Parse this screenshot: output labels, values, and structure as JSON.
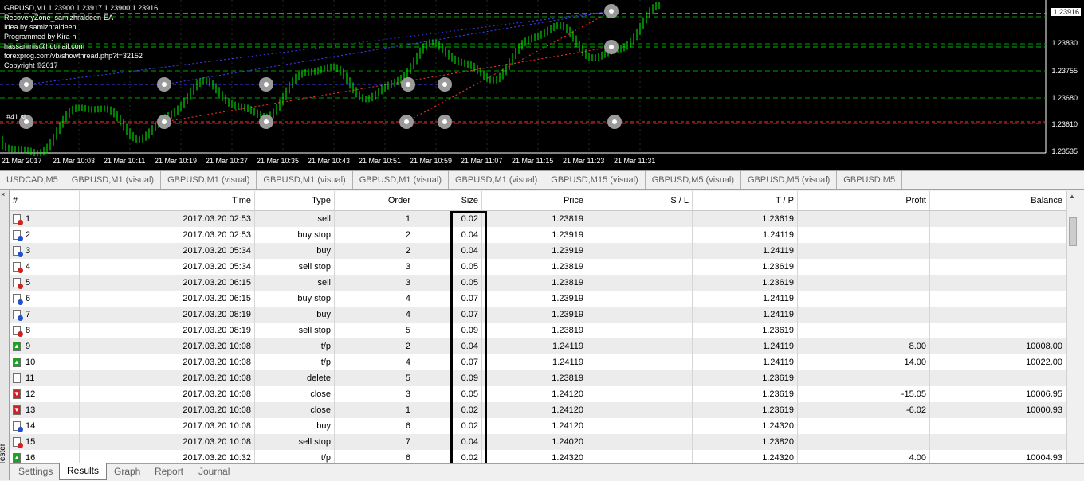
{
  "chart": {
    "ohlc_line": "GBPUSD,M1  1.23900 1.23917 1.23900 1.23916",
    "overlay_lines": [
      "RecoveryZone_samizhraldeen-EA",
      "Idea by samizhraldeen",
      "Programmed by Kira-h",
      "hassanrnis@hotmail.com",
      "forexprog.com/vb/showthread.php?t=32152",
      "Copyright ©2017"
    ],
    "order_label": "#41 sl",
    "price_current": "1.23916",
    "price_labels": [
      "1.23830",
      "1.23755",
      "1.23680",
      "1.23610",
      "1.23535"
    ],
    "time_labels": [
      "21 Mar 2017",
      "21 Mar 10:03",
      "21 Mar 10:11",
      "21 Mar 10:19",
      "21 Mar 10:27",
      "21 Mar 10:35",
      "21 Mar 10:43",
      "21 Mar 10:51",
      "21 Mar 10:59",
      "21 Mar 11:07",
      "21 Mar 11:15",
      "21 Mar 11:23",
      "21 Mar 11:31"
    ],
    "colors": {
      "background": "#000000",
      "candles": "#00ff00",
      "buy_line": "#4040ff",
      "sell_line": "#ff3030",
      "grid": "#00a000"
    }
  },
  "chart_tabs": [
    "USDCAD,M5",
    "GBPUSD,M1 (visual)",
    "GBPUSD,M1 (visual)",
    "GBPUSD,M1 (visual)",
    "GBPUSD,M1 (visual)",
    "GBPUSD,M1 (visual)",
    "GBPUSD,M15 (visual)",
    "GBPUSD,M5 (visual)",
    "GBPUSD,M5 (visual)",
    "GBPUSD,M5"
  ],
  "table": {
    "columns": [
      "#",
      "Time",
      "Type",
      "Order",
      "Size",
      "Price",
      "S / L",
      "T / P",
      "Profit",
      "Balance"
    ],
    "rows": [
      {
        "icon": "sell-icon",
        "num": "1",
        "time": "2017.03.20 02:53",
        "type": "sell",
        "order": "1",
        "size": "0.02",
        "price": "1.23819",
        "sl": "",
        "tp": "1.23619",
        "profit": "",
        "balance": ""
      },
      {
        "icon": "buy-stop-icon",
        "num": "2",
        "time": "2017.03.20 02:53",
        "type": "buy stop",
        "order": "2",
        "size": "0.04",
        "price": "1.23919",
        "sl": "",
        "tp": "1.24119",
        "profit": "",
        "balance": ""
      },
      {
        "icon": "buy-icon",
        "num": "3",
        "time": "2017.03.20 05:34",
        "type": "buy",
        "order": "2",
        "size": "0.04",
        "price": "1.23919",
        "sl": "",
        "tp": "1.24119",
        "profit": "",
        "balance": ""
      },
      {
        "icon": "sell-stop-icon",
        "num": "4",
        "time": "2017.03.20 05:34",
        "type": "sell stop",
        "order": "3",
        "size": "0.05",
        "price": "1.23819",
        "sl": "",
        "tp": "1.23619",
        "profit": "",
        "balance": ""
      },
      {
        "icon": "sell-icon",
        "num": "5",
        "time": "2017.03.20 06:15",
        "type": "sell",
        "order": "3",
        "size": "0.05",
        "price": "1.23819",
        "sl": "",
        "tp": "1.23619",
        "profit": "",
        "balance": ""
      },
      {
        "icon": "buy-stop-icon",
        "num": "6",
        "time": "2017.03.20 06:15",
        "type": "buy stop",
        "order": "4",
        "size": "0.07",
        "price": "1.23919",
        "sl": "",
        "tp": "1.24119",
        "profit": "",
        "balance": ""
      },
      {
        "icon": "buy-icon",
        "num": "7",
        "time": "2017.03.20 08:19",
        "type": "buy",
        "order": "4",
        "size": "0.07",
        "price": "1.23919",
        "sl": "",
        "tp": "1.24119",
        "profit": "",
        "balance": ""
      },
      {
        "icon": "sell-stop-icon",
        "num": "8",
        "time": "2017.03.20 08:19",
        "type": "sell stop",
        "order": "5",
        "size": "0.09",
        "price": "1.23819",
        "sl": "",
        "tp": "1.23619",
        "profit": "",
        "balance": ""
      },
      {
        "icon": "take-profit-icon",
        "num": "9",
        "time": "2017.03.20 10:08",
        "type": "t/p",
        "order": "2",
        "size": "0.04",
        "price": "1.24119",
        "sl": "",
        "tp": "1.24119",
        "profit": "8.00",
        "balance": "10008.00"
      },
      {
        "icon": "take-profit-icon",
        "num": "10",
        "time": "2017.03.20 10:08",
        "type": "t/p",
        "order": "4",
        "size": "0.07",
        "price": "1.24119",
        "sl": "",
        "tp": "1.24119",
        "profit": "14.00",
        "balance": "10022.00"
      },
      {
        "icon": "delete-icon",
        "num": "11",
        "time": "2017.03.20 10:08",
        "type": "delete",
        "order": "5",
        "size": "0.09",
        "price": "1.23819",
        "sl": "",
        "tp": "1.23619",
        "profit": "",
        "balance": ""
      },
      {
        "icon": "close-loss-icon",
        "num": "12",
        "time": "2017.03.20 10:08",
        "type": "close",
        "order": "3",
        "size": "0.05",
        "price": "1.24120",
        "sl": "",
        "tp": "1.23619",
        "profit": "-15.05",
        "balance": "10006.95"
      },
      {
        "icon": "close-loss-icon",
        "num": "13",
        "time": "2017.03.20 10:08",
        "type": "close",
        "order": "1",
        "size": "0.02",
        "price": "1.24120",
        "sl": "",
        "tp": "1.23619",
        "profit": "-6.02",
        "balance": "10000.93"
      },
      {
        "icon": "buy-icon",
        "num": "14",
        "time": "2017.03.20 10:08",
        "type": "buy",
        "order": "6",
        "size": "0.02",
        "price": "1.24120",
        "sl": "",
        "tp": "1.24320",
        "profit": "",
        "balance": ""
      },
      {
        "icon": "sell-stop-icon",
        "num": "15",
        "time": "2017.03.20 10:08",
        "type": "sell stop",
        "order": "7",
        "size": "0.04",
        "price": "1.24020",
        "sl": "",
        "tp": "1.23820",
        "profit": "",
        "balance": ""
      },
      {
        "icon": "take-profit-icon",
        "num": "16",
        "time": "2017.03.20 10:32",
        "type": "t/p",
        "order": "6",
        "size": "0.02",
        "price": "1.24320",
        "sl": "",
        "tp": "1.24320",
        "profit": "4.00",
        "balance": "10004.93"
      }
    ]
  },
  "sidebar": {
    "label": "Tester",
    "close": "×"
  },
  "bottom_tabs": [
    "Settings",
    "Results",
    "Graph",
    "Report",
    "Journal"
  ],
  "selected_tab": "Results"
}
